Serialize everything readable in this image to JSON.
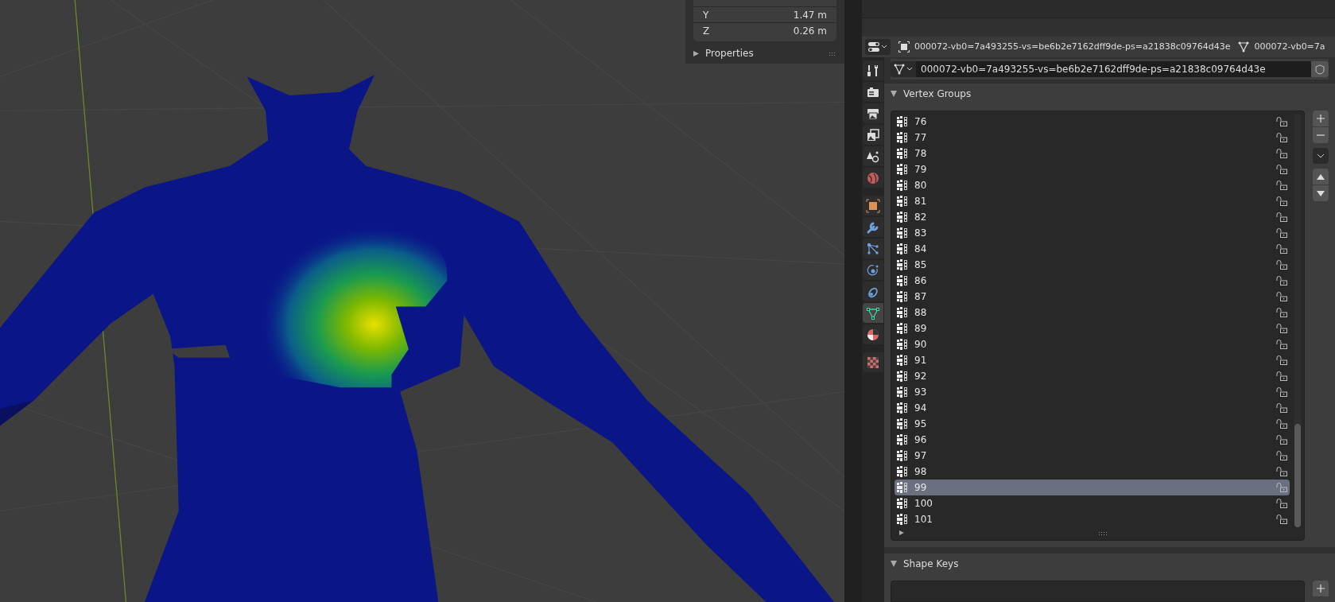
{
  "viewport": {
    "transform": [
      {
        "axis": "Y",
        "value": "1.47 m"
      },
      {
        "axis": "Z",
        "value": "0.26 m"
      }
    ],
    "properties_panel": {
      "label": "Properties",
      "expanded": false
    }
  },
  "properties_editor": {
    "breadcrumb": [
      {
        "kind": "object",
        "label": "000072-vb0=7a493255-vs=be6b2e7162dff9de-ps=a21838c09764d43e"
      },
      {
        "kind": "mesh",
        "label": "000072-vb0=7a"
      }
    ],
    "tabs": [
      {
        "kind": "tool",
        "selected": false
      },
      {
        "kind": "render",
        "selected": false
      },
      {
        "kind": "output",
        "selected": false
      },
      {
        "kind": "view_layer",
        "selected": false
      },
      {
        "kind": "scene",
        "selected": false
      },
      {
        "kind": "world",
        "selected": false
      },
      {
        "kind": "object",
        "selected": false
      },
      {
        "kind": "modifier",
        "selected": false
      },
      {
        "kind": "particles",
        "selected": false
      },
      {
        "kind": "physics",
        "selected": false
      },
      {
        "kind": "constraints",
        "selected": false
      },
      {
        "kind": "data",
        "selected": true
      },
      {
        "kind": "material",
        "selected": false
      },
      {
        "kind": "texture",
        "selected": false
      }
    ],
    "data_name": "000072-vb0=7a493255-vs=be6b2e7162dff9de-ps=a21838c09764d43e",
    "vertex_groups": {
      "title": "Vertex Groups",
      "expanded": true,
      "groups": [
        {
          "name": "76",
          "selected": false
        },
        {
          "name": "77",
          "selected": false
        },
        {
          "name": "78",
          "selected": false
        },
        {
          "name": "79",
          "selected": false
        },
        {
          "name": "80",
          "selected": false
        },
        {
          "name": "81",
          "selected": false
        },
        {
          "name": "82",
          "selected": false
        },
        {
          "name": "83",
          "selected": false
        },
        {
          "name": "84",
          "selected": false
        },
        {
          "name": "85",
          "selected": false
        },
        {
          "name": "86",
          "selected": false
        },
        {
          "name": "87",
          "selected": false
        },
        {
          "name": "88",
          "selected": false
        },
        {
          "name": "89",
          "selected": false
        },
        {
          "name": "90",
          "selected": false
        },
        {
          "name": "91",
          "selected": false
        },
        {
          "name": "92",
          "selected": false
        },
        {
          "name": "93",
          "selected": false
        },
        {
          "name": "94",
          "selected": false
        },
        {
          "name": "95",
          "selected": false
        },
        {
          "name": "96",
          "selected": false
        },
        {
          "name": "97",
          "selected": false
        },
        {
          "name": "98",
          "selected": false
        },
        {
          "name": "99",
          "selected": true
        },
        {
          "name": "100",
          "selected": false
        },
        {
          "name": "101",
          "selected": false
        }
      ]
    },
    "shape_keys": {
      "title": "Shape Keys",
      "expanded": true
    }
  }
}
